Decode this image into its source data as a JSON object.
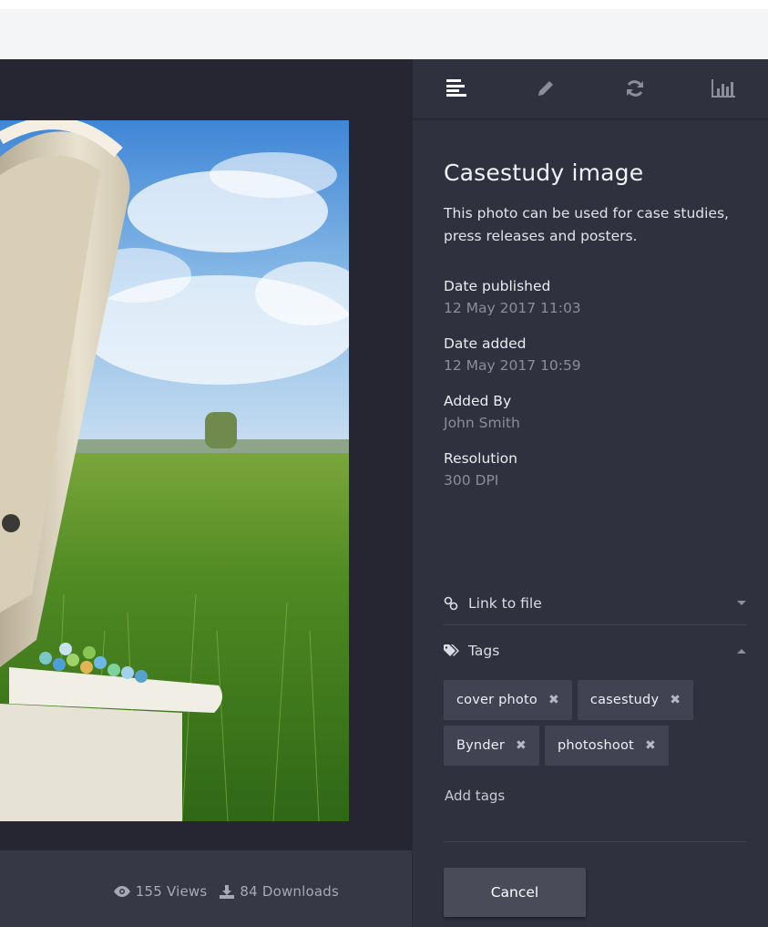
{
  "toolbar": {
    "tools": [
      {
        "name": "info",
        "icon": "info-list-icon"
      },
      {
        "name": "edit",
        "icon": "pencil-icon"
      },
      {
        "name": "versions",
        "icon": "refresh-icon"
      },
      {
        "name": "statistics",
        "icon": "bar-chart-icon"
      }
    ]
  },
  "asset": {
    "title": "Casestudy image",
    "description": "This photo can be used for case studies, press releases and posters.",
    "meta": [
      {
        "label": "Date published",
        "value": "12 May  2017 11:03"
      },
      {
        "label": "Date added",
        "value": "12 May  2017 10:59"
      },
      {
        "label": "Added By",
        "value": "John Smith"
      },
      {
        "label": "Resolution",
        "value": "300 DPI"
      }
    ]
  },
  "sections": {
    "link_label": "Link to file",
    "tags_label": "Tags"
  },
  "tags": [
    "cover photo",
    "casestudy",
    "Bynder",
    "photoshoot"
  ],
  "tag_remove_glyph": "✖",
  "add_tags_label": "Add tags",
  "stats": {
    "views": "155 Views",
    "downloads": "84 Downloads"
  },
  "footer": {
    "cancel_label": "Cancel"
  },
  "colors": {
    "viewer_bg": "#252632",
    "panel_bg": "#30313e",
    "tag_bg": "#424352",
    "button_bg": "#4a4b58"
  }
}
